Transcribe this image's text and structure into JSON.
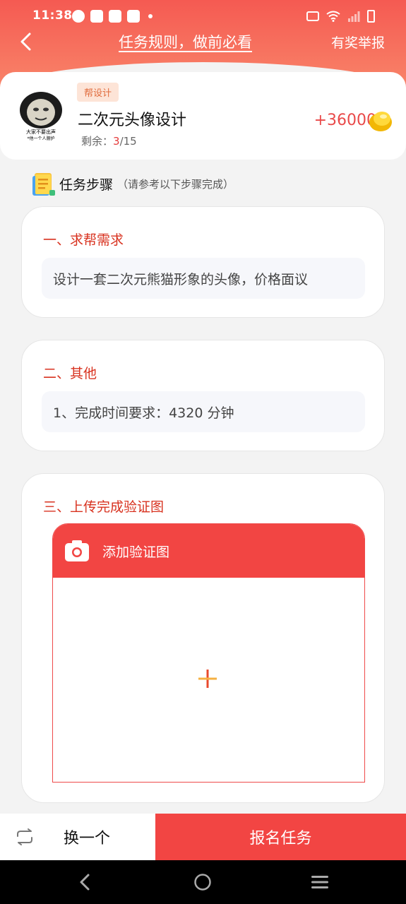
{
  "status_bar": {
    "time": "11:38"
  },
  "nav": {
    "title": "任务规则，做前必看",
    "report": "有奖举报"
  },
  "task": {
    "tag": "帮设计",
    "name": "二次元头像设计",
    "remain_label": "剩余：",
    "remain_current": "3",
    "remain_total": "/15",
    "reward": "+36000",
    "avatar_caption_1": "大家不要出声",
    "avatar_caption_2": "*他一个人臆护"
  },
  "steps": {
    "title": "任务步骤",
    "subtitle": "（请参考以下步骤完成）",
    "items": [
      {
        "heading": "一、求帮需求",
        "content": "设计一套二次元熊猫形象的头像，价格面议"
      },
      {
        "heading": "二、其他",
        "content": "1、完成时间要求：4320 分钟"
      },
      {
        "heading": "三、上传完成验证图",
        "upload_label": "添加验证图"
      }
    ]
  },
  "bottom": {
    "swap_label": "换一个",
    "signup_label": "报名任务"
  },
  "colors": {
    "accent": "#f24543",
    "header": "#f55a52",
    "heading_red": "#d8321f",
    "tag_bg": "#fde4d7"
  }
}
